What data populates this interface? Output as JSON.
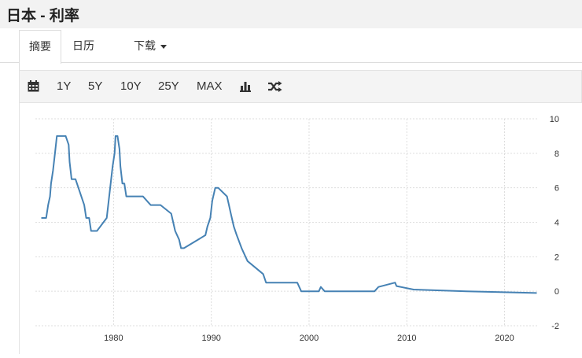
{
  "header": {
    "title": "日本 - 利率"
  },
  "tabs": [
    {
      "label": "摘要"
    },
    {
      "label": "日历"
    },
    {
      "label": "下载"
    }
  ],
  "toolbar": {
    "ranges": [
      "1Y",
      "5Y",
      "10Y",
      "25Y",
      "MAX"
    ],
    "icons": [
      "calendar-icon",
      "bar-chart-icon",
      "shuffle-icon"
    ]
  },
  "colors": {
    "line": "#4682b4",
    "grid": "#dddddd",
    "toolbar_bg": "#f4f4f4"
  },
  "chart_data": {
    "type": "line",
    "xlabel": "",
    "ylabel": "",
    "xlim": [
      1972,
      2023.5
    ],
    "ylim": [
      -2,
      10
    ],
    "x_ticks": [
      1980,
      1990,
      2000,
      2010,
      2020
    ],
    "y_ticks": [
      10,
      8,
      6,
      4,
      2,
      0,
      -2
    ],
    "grid": true,
    "series": [
      {
        "x": [
          1972.6,
          1973.1,
          1973.3,
          1973.5,
          1973.6,
          1973.8,
          1974.0,
          1974.2,
          1975.1,
          1975.4,
          1975.5,
          1975.7,
          1976.1,
          1977.0,
          1977.2,
          1977.5,
          1977.7,
          1978.1,
          1978.3,
          1979.3,
          1979.5,
          1979.7,
          1979.9,
          1980.1,
          1980.2,
          1980.4,
          1980.6,
          1980.7,
          1980.9,
          1981.1,
          1981.3,
          1981.6,
          1981.8,
          1983.0,
          1983.8,
          1984.8,
          1985.9,
          1986.1,
          1986.3,
          1986.7,
          1986.9,
          1987.2,
          1989.4,
          1989.6,
          1989.9,
          1990.1,
          1990.4,
          1990.7,
          1991.6,
          1991.8,
          1992.0,
          1992.3,
          1992.6,
          1993.1,
          1993.7,
          1995.3,
          1995.6,
          1998.8,
          1999.2,
          2001.0,
          2001.2,
          2001.6,
          2006.7,
          2007.1,
          2008.8,
          2008.95,
          2010.7,
          2016.1,
          2023.3
        ],
        "y": [
          4.25,
          4.25,
          5.0,
          5.5,
          6.25,
          7.0,
          8.0,
          9.0,
          9.0,
          8.5,
          7.5,
          6.5,
          6.5,
          5.0,
          4.25,
          4.25,
          3.5,
          3.5,
          3.5,
          4.25,
          5.25,
          6.25,
          7.25,
          8.0,
          9.0,
          9.0,
          8.25,
          7.25,
          6.25,
          6.25,
          5.5,
          5.5,
          5.5,
          5.5,
          5.0,
          5.0,
          4.5,
          4.0,
          3.5,
          3.0,
          2.5,
          2.5,
          3.25,
          3.75,
          4.25,
          5.25,
          6.0,
          6.0,
          5.5,
          5.0,
          4.5,
          3.75,
          3.25,
          2.5,
          1.75,
          1.0,
          0.5,
          0.5,
          0.0,
          0.0,
          0.25,
          0.0,
          0.0,
          0.25,
          0.5,
          0.3,
          0.1,
          0.0,
          -0.1
        ]
      }
    ]
  }
}
